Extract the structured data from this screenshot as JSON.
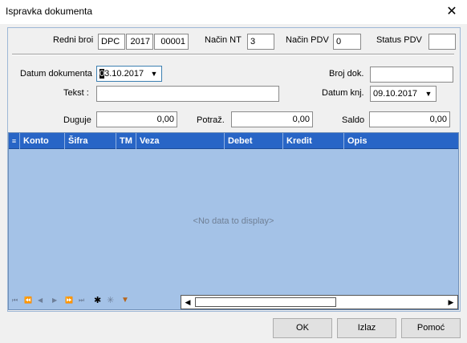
{
  "window": {
    "title": "Ispravka dokumenta",
    "close_glyph": "✕"
  },
  "header": {
    "redni_broj_label": "Redni broi",
    "redni_broj_a": "DPC",
    "redni_broj_b": "2017",
    "redni_broj_c": "00001",
    "nacin_nt_label": "Način NT",
    "nacin_nt_value": "3",
    "nacin_pdv_label": "Način PDV",
    "nacin_pdv_value": "0",
    "status_pdv_label": "Status PDV",
    "status_pdv_value": ""
  },
  "form": {
    "datum_dokumenta_label": "Datum dokumenta",
    "datum_dokumenta_caret": "0",
    "datum_dokumenta_rest": "3.10.2017",
    "broj_dok_label": "Broj dok.",
    "broj_dok_value": "",
    "tekst_label": "Tekst :",
    "tekst_value": "",
    "datum_knj_label": "Datum knj.",
    "datum_knj_value": "09.10.2017",
    "duguje_label": "Duguje",
    "duguje_value": "0,00",
    "potraz_label": "Potraž.",
    "potraz_value": "0,00",
    "saldo_label": "Saldo",
    "saldo_value": "0,00"
  },
  "grid": {
    "columns": [
      "Konto",
      "Šifra",
      "TM",
      "Veza",
      "Debet",
      "Kredit",
      "Opis"
    ],
    "empty_text": "<No data to display>",
    "nav_icons": [
      "first-icon",
      "prev-page-icon",
      "prev-icon",
      "next-icon",
      "next-page-icon",
      "last-icon",
      "insert-icon",
      "delete-icon",
      "filter-icon"
    ]
  },
  "buttons": {
    "ok": "OK",
    "izlaz": "Izlaz",
    "pomoc": "Pomoć"
  },
  "colors": {
    "grid_header": "#2865c6",
    "grid_body": "#a4c2e7"
  }
}
